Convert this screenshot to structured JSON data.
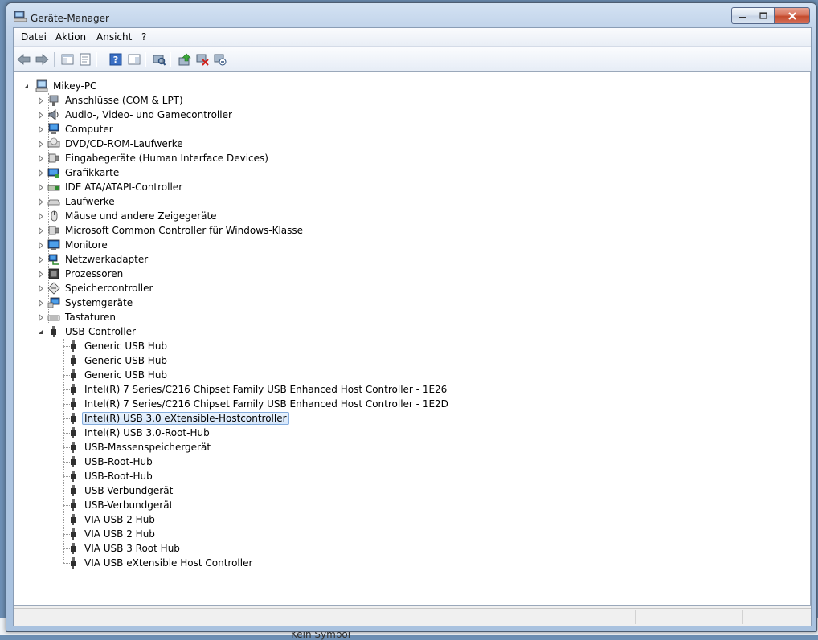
{
  "window": {
    "title": "Geräte-Manager"
  },
  "menubar": {
    "items": [
      {
        "label": "Datei"
      },
      {
        "label": "Aktion"
      },
      {
        "label": "Ansicht"
      },
      {
        "label": "?"
      }
    ]
  },
  "toolbar": {
    "buttons": [
      {
        "icon": "back-arrow-icon"
      },
      {
        "icon": "forward-arrow-icon"
      },
      {
        "icon": "show-hide-console-tree-icon"
      },
      {
        "icon": "properties-icon"
      },
      {
        "icon": "help-icon"
      },
      {
        "icon": "show-action-pane-icon"
      },
      {
        "icon": "scan-hardware-icon"
      },
      {
        "icon": "update-driver-icon"
      },
      {
        "icon": "disable-device-icon"
      },
      {
        "icon": "uninstall-device-icon"
      }
    ]
  },
  "tree": {
    "root": {
      "label": "Mikey-PC",
      "expanded": true
    },
    "categories": [
      {
        "label": "Anschlüsse (COM & LPT)",
        "icon": "port-icon"
      },
      {
        "label": "Audio-, Video- und Gamecontroller",
        "icon": "speaker-icon"
      },
      {
        "label": "Computer",
        "icon": "computer-icon"
      },
      {
        "label": "DVD/CD-ROM-Laufwerke",
        "icon": "dvd-drive-icon"
      },
      {
        "label": "Eingabegeräte (Human Interface Devices)",
        "icon": "hid-icon"
      },
      {
        "label": "Grafikkarte",
        "icon": "display-adapter-icon"
      },
      {
        "label": "IDE ATA/ATAPI-Controller",
        "icon": "ide-controller-icon"
      },
      {
        "label": "Laufwerke",
        "icon": "disk-drive-icon"
      },
      {
        "label": "Mäuse und andere Zeigegeräte",
        "icon": "mouse-icon"
      },
      {
        "label": "Microsoft Common Controller für Windows-Klasse",
        "icon": "hid-icon"
      },
      {
        "label": "Monitore",
        "icon": "monitor-icon"
      },
      {
        "label": "Netzwerkadapter",
        "icon": "network-adapter-icon"
      },
      {
        "label": "Prozessoren",
        "icon": "processor-icon"
      },
      {
        "label": "Speichercontroller",
        "icon": "storage-controller-icon"
      },
      {
        "label": "Systemgeräte",
        "icon": "system-device-icon"
      },
      {
        "label": "Tastaturen",
        "icon": "keyboard-icon"
      },
      {
        "label": "USB-Controller",
        "icon": "usb-icon",
        "expanded": true
      }
    ],
    "usb_devices": [
      {
        "label": "Generic USB Hub"
      },
      {
        "label": "Generic USB Hub"
      },
      {
        "label": "Generic USB Hub"
      },
      {
        "label": "Intel(R) 7 Series/C216 Chipset Family USB Enhanced Host Controller - 1E26"
      },
      {
        "label": "Intel(R) 7 Series/C216 Chipset Family USB Enhanced Host Controller - 1E2D"
      },
      {
        "label": "Intel(R) USB 3.0 eXtensible-Hostcontroller",
        "selected": true
      },
      {
        "label": "Intel(R) USB 3.0-Root-Hub"
      },
      {
        "label": "USB-Massenspeichergerät"
      },
      {
        "label": "USB-Root-Hub"
      },
      {
        "label": "USB-Root-Hub"
      },
      {
        "label": "USB-Verbundgerät"
      },
      {
        "label": "USB-Verbundgerät"
      },
      {
        "label": "VIA USB 2 Hub"
      },
      {
        "label": "VIA USB 2 Hub"
      },
      {
        "label": "VIA USB 3 Root Hub"
      },
      {
        "label": "VIA USB eXtensible Host Controller"
      }
    ]
  },
  "background": {
    "text": "Kein Symbol"
  },
  "colors": {
    "selection_border": "#84acdd",
    "selection_fill": "#dce9fb",
    "close_button": "#c44a2c"
  }
}
